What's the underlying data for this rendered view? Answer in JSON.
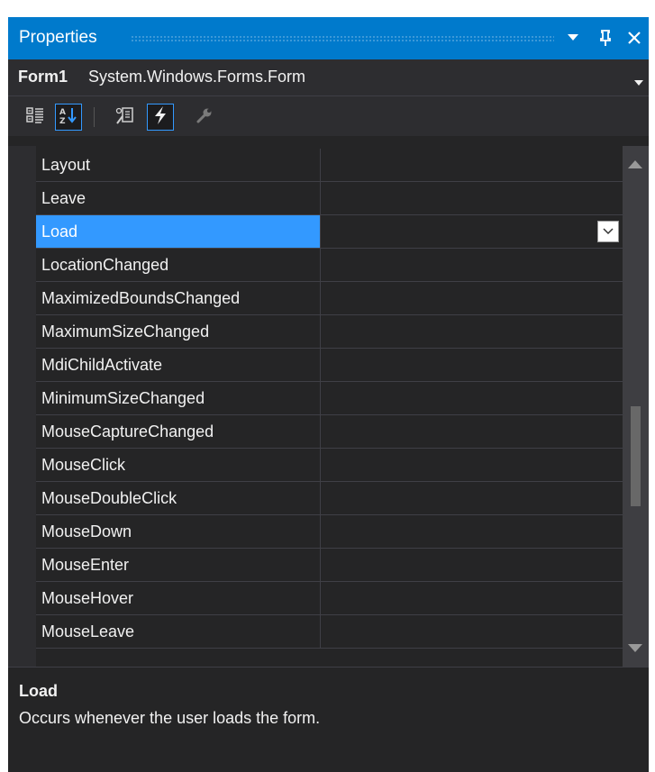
{
  "window": {
    "title": "Properties",
    "icons": [
      "dropdown-caret-icon",
      "pin-icon",
      "close-icon"
    ]
  },
  "object_selector": {
    "name": "Form1",
    "type": "System.Windows.Forms.Form"
  },
  "toolbar": {
    "buttons": [
      {
        "name": "categorized-icon",
        "active": false
      },
      {
        "name": "alphabetical-icon",
        "active": true
      },
      {
        "name": "properties-icon",
        "active": false
      },
      {
        "name": "events-icon",
        "active": true
      },
      {
        "name": "property-pages-icon",
        "active": false
      }
    ]
  },
  "grid": {
    "selected": "Load",
    "rows": [
      "Layout",
      "Leave",
      "Load",
      "LocationChanged",
      "MaximizedBoundsChanged",
      "MaximumSizeChanged",
      "MdiChildActivate",
      "MinimumSizeChanged",
      "MouseCaptureChanged",
      "MouseClick",
      "MouseDoubleClick",
      "MouseDown",
      "MouseEnter",
      "MouseHover",
      "MouseLeave"
    ]
  },
  "description": {
    "title": "Load",
    "text": "Occurs whenever the user loads the form."
  },
  "colors": {
    "accent": "#007acc",
    "selection": "#3399ff",
    "background": "#252526"
  }
}
